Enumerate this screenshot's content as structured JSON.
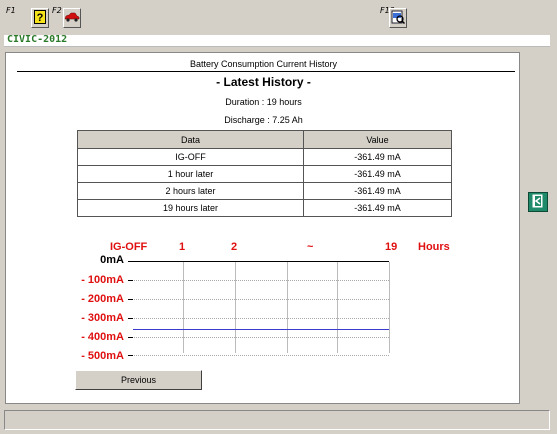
{
  "toolbar": {
    "f1_label": "F1",
    "f2_label": "F2",
    "f12_label": "F12",
    "f1_icon": "help-question-icon",
    "f2_icon": "car-icon",
    "f12_icon": "print-preview-icon"
  },
  "model": "CIVIC-2012",
  "report": {
    "title": "Battery Consumption Current History",
    "history_title": "- Latest History -",
    "duration": "Duration : 19 hours",
    "discharge": "Discharge : 7.25 Ah"
  },
  "table": {
    "headers": [
      "Data",
      "Value"
    ],
    "rows": [
      [
        "IG-OFF",
        "-361.49 mA"
      ],
      [
        "1 hour later",
        "-361.49 mA"
      ],
      [
        "2 hours later",
        "-361.49 mA"
      ],
      [
        "19 hours later",
        "-361.49 mA"
      ]
    ]
  },
  "chart_data": {
    "type": "line",
    "x_ticks": [
      "IG-OFF",
      "1",
      "2",
      "~",
      "19"
    ],
    "x_unit": "Hours",
    "y_ticks": [
      "0mA",
      "- 100mA",
      "- 200mA",
      "- 300mA",
      "- 400mA",
      "- 500mA"
    ],
    "ylim": [
      -500,
      0
    ],
    "series": [
      {
        "values": [
          -361.49,
          -361.49,
          -361.49,
          -361.49,
          -361.49
        ]
      }
    ],
    "grid": true,
    "line_color": "#3a3acc",
    "label_color": "#e01010"
  },
  "buttons": {
    "previous": "Previous",
    "side_icon": "exit-door-icon"
  }
}
